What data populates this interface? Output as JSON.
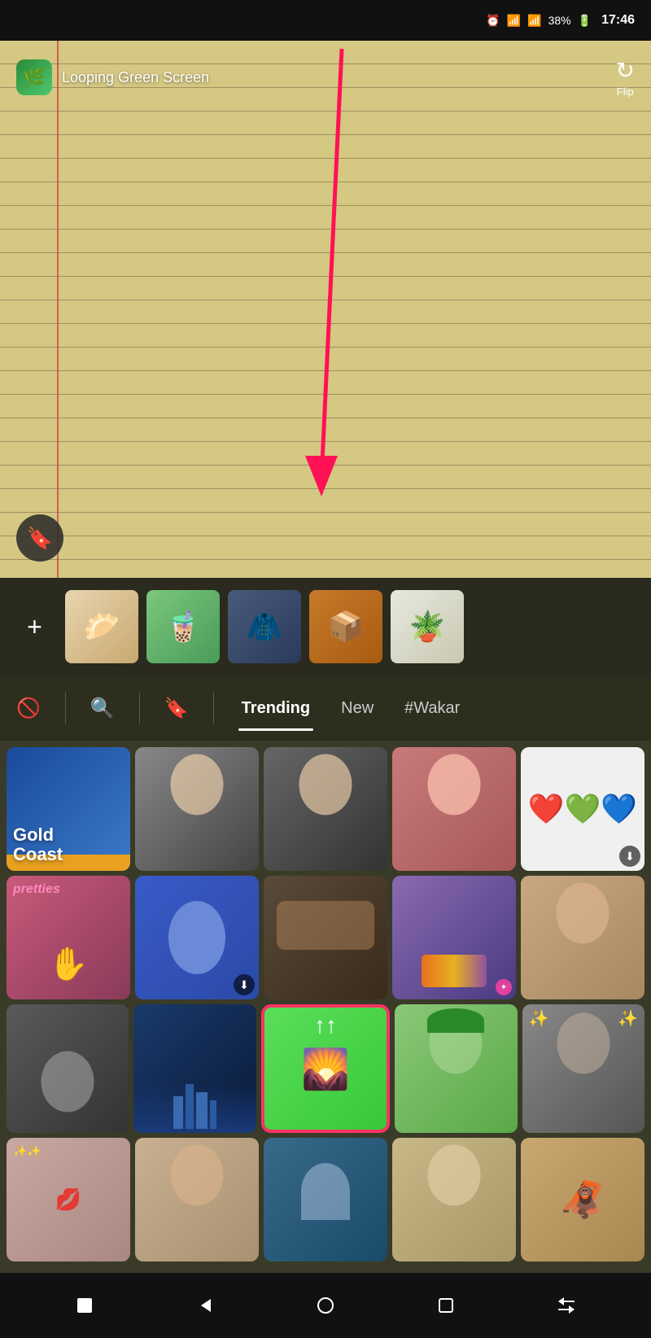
{
  "statusBar": {
    "time": "17:46",
    "battery": "38%",
    "icons": [
      "alarm",
      "wifi",
      "signal",
      "battery"
    ]
  },
  "appBar": {
    "appName": "Looping Green Screen",
    "flipLabel": "Flip",
    "flipIcon": "↻"
  },
  "thumbStrip": {
    "addLabel": "+",
    "items": [
      {
        "type": "food",
        "emoji": "🥟"
      },
      {
        "type": "drinks",
        "emoji": "🧋"
      },
      {
        "type": "jacket",
        "emoji": "🧥"
      },
      {
        "type": "product",
        "emoji": "📦"
      },
      {
        "type": "plant",
        "emoji": "🪴"
      }
    ]
  },
  "filterBar": {
    "tabs": [
      {
        "label": "Trending",
        "active": true
      },
      {
        "label": "New",
        "active": false
      },
      {
        "label": "#Wakar",
        "active": false
      }
    ],
    "icons": [
      "ban",
      "search",
      "bookmark"
    ]
  },
  "grid": {
    "row1": [
      {
        "type": "gold-coast",
        "text": "Gold Coast"
      },
      {
        "type": "face-bw"
      },
      {
        "type": "face-bw2"
      },
      {
        "type": "face-color"
      },
      {
        "type": "hearts",
        "content": "❤️💚💙"
      }
    ],
    "row2": [
      {
        "type": "hand"
      },
      {
        "type": "blue-balloon"
      },
      {
        "type": "face-closeup"
      },
      {
        "type": "sky-landscape"
      },
      {
        "type": "asian-face"
      }
    ],
    "row3": [
      {
        "type": "sleeping"
      },
      {
        "type": "city-night"
      },
      {
        "type": "featured-greenscreen"
      },
      {
        "type": "green-hat"
      },
      {
        "type": "xmas"
      }
    ],
    "row4": [
      {
        "type": "lips"
      },
      {
        "type": "asian2"
      },
      {
        "type": "lake"
      },
      {
        "type": "blonde"
      },
      {
        "type": "monkey"
      }
    ]
  },
  "navBar": {
    "buttons": [
      "square",
      "back",
      "home",
      "recents",
      "switch"
    ]
  },
  "arrow": {
    "color": "#ff1155"
  }
}
